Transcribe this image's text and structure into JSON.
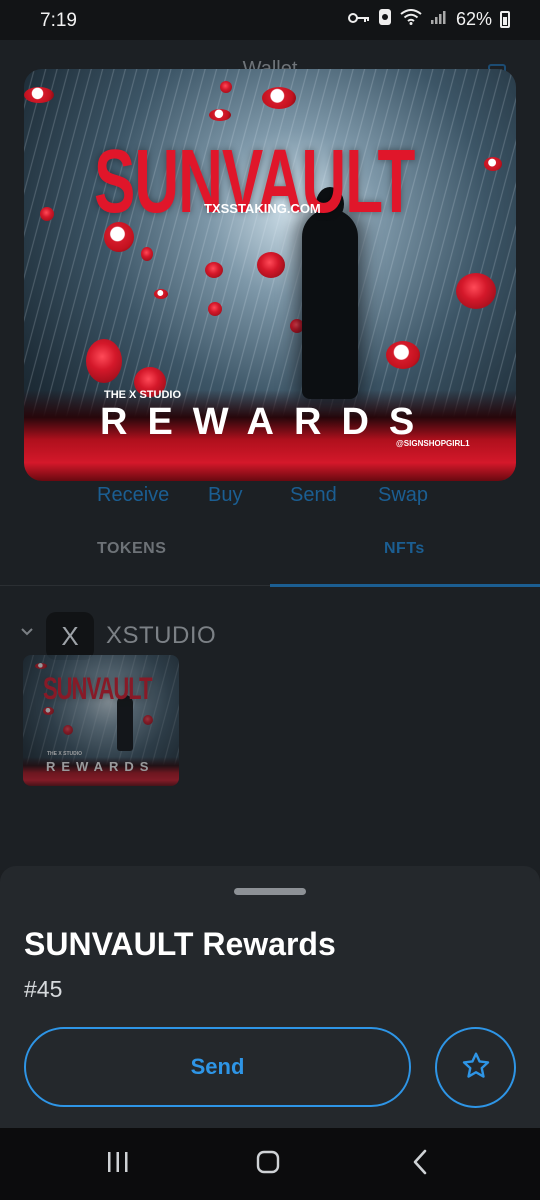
{
  "status_bar": {
    "time": "7:19",
    "battery": "62%"
  },
  "wallet": {
    "title": "Wallet",
    "actions": [
      "Receive",
      "Buy",
      "Send",
      "Swap"
    ],
    "tabs": [
      "TOKENS",
      "NFTs"
    ],
    "active_tab": "NFTs",
    "collection": {
      "logo_letter": "X",
      "name": "XSTUDIO"
    }
  },
  "artwork": {
    "title": "SUNVAULT",
    "website": "TXSSTAKING.COM",
    "studio": "THE X STUDIO",
    "headline": "REWARDS",
    "credit": "@SIGNSHOPGIRL1"
  },
  "thumbnail": {
    "title": "SUNVAULT",
    "studio": "THE X STUDIO",
    "headline": "REWARDS"
  },
  "sheet": {
    "nft_name": "SUNVAULT Rewards",
    "nft_number": "#45",
    "send_label": "Send"
  },
  "colors": {
    "accent": "#2e95e6",
    "art_red": "#e0162a",
    "sheet_bg": "#24282c"
  },
  "icons": {
    "favorite": "star-icon",
    "nav": [
      "recents-icon",
      "home-icon",
      "back-icon"
    ]
  }
}
